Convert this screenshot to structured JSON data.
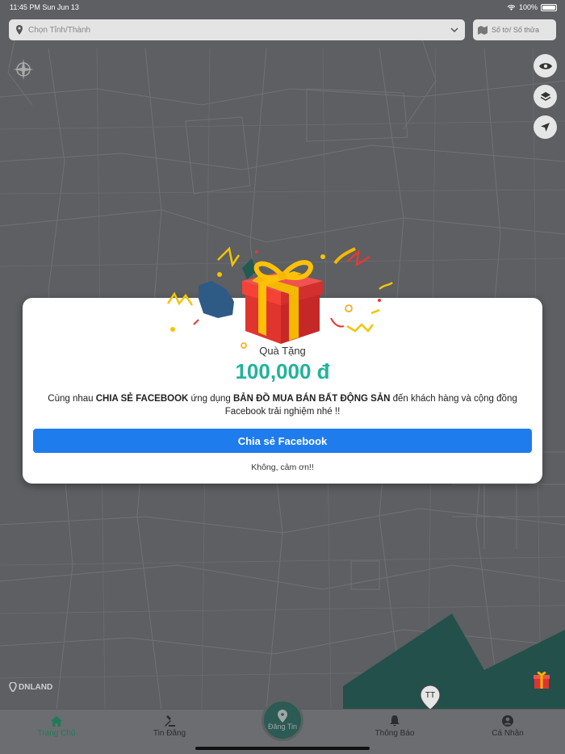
{
  "status_bar": {
    "time": "11:45 PM",
    "date": "Sun Jun 13",
    "battery": "100%"
  },
  "search": {
    "placeholder": "Chọn Tỉnh/Thành"
  },
  "parcel_button": {
    "label": "Số tờ/ Số thửa"
  },
  "map": {
    "logo": "DNLAND",
    "pin_label": "TT"
  },
  "modal": {
    "title": "Quà Tặng",
    "amount": "100,000 đ",
    "message_prefix": "Cùng nhau ",
    "message_bold1": "CHIA SẺ FACEBOOK",
    "message_mid": " ứng dụng ",
    "message_bold2": "BẢN ĐỒ MUA BÁN BẤT ĐỘNG SẢN",
    "message_suffix": " đến khách hàng và cộng đồng Facebook trải nghiệm nhé !!",
    "share_button": "Chia sẻ Facebook",
    "decline_button": "Không, cảm ơn!!"
  },
  "tabs": {
    "home": "Trang Chủ",
    "listings": "Tin Đăng",
    "post": "Đăng Tin",
    "notifications": "Thông Báo",
    "profile": "Cá Nhân"
  },
  "colors": {
    "accent": "#21b39a",
    "facebook": "#1f7cec",
    "active_tab": "#1f7a5a"
  }
}
